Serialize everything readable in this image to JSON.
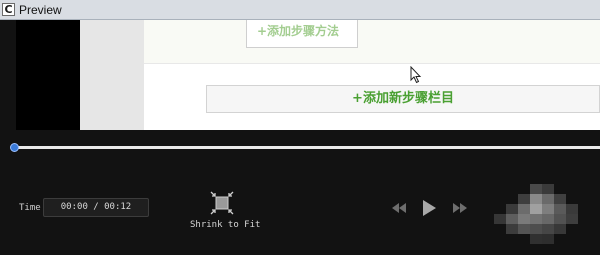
{
  "window": {
    "title": "Preview",
    "icon": "preview-app-icon"
  },
  "video": {
    "partial_button_label": "+添加步骤方法",
    "add_button_label": "+添加新步骤栏目"
  },
  "timeline": {
    "progress": 0.0
  },
  "controls": {
    "time_label": "Time",
    "time_value": "00:00 / 00:12",
    "shrink_label": "Shrink to Fit",
    "prev_icon": "skip-back-icon",
    "play_icon": "play-icon",
    "next_icon": "skip-forward-icon"
  },
  "colors": {
    "accent_green": "#4aa032",
    "playhead_blue": "#3a7ad8",
    "background": "#121212"
  }
}
